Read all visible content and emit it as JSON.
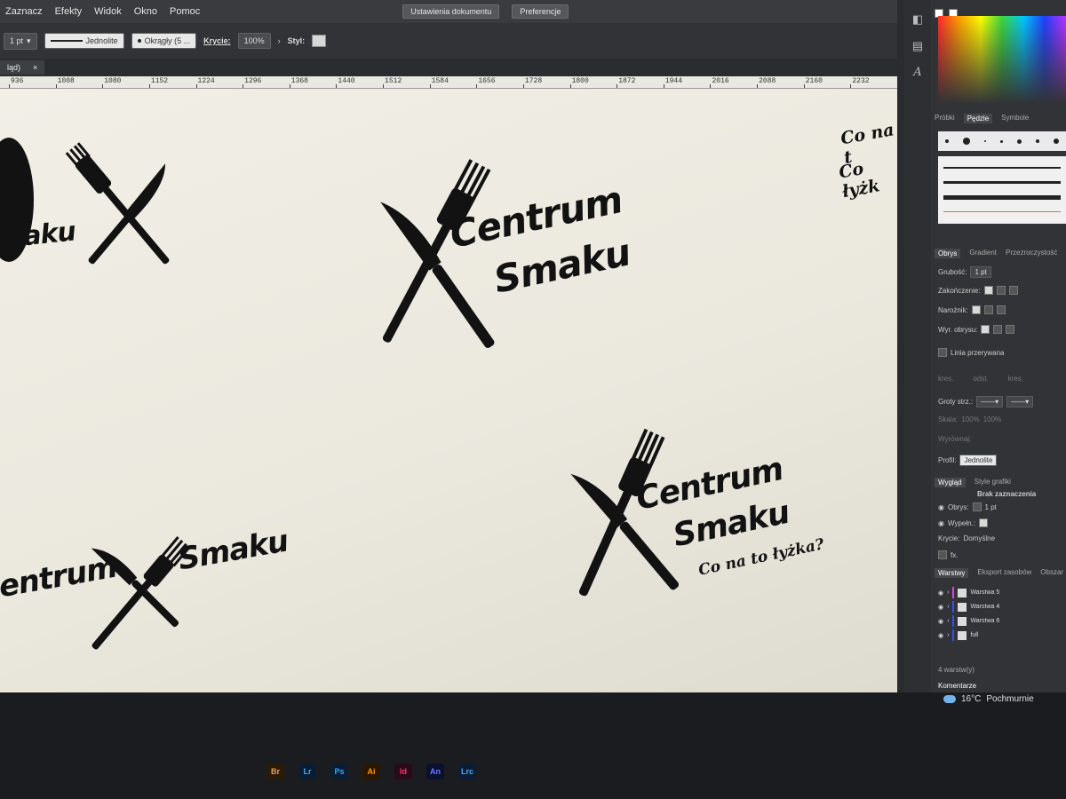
{
  "menu": {
    "items": [
      "Zaznacz",
      "Efekty",
      "Widok",
      "Okno",
      "Pomoc"
    ],
    "document_settings": "Ustawienia dokumentu",
    "preferences": "Preferencje"
  },
  "control_bar": {
    "stroke_weight": "1 pt",
    "stroke_style": "Jednolite",
    "brush": "Okrągły (5 ...",
    "opacity_label": "Krycie:",
    "opacity_value": "100%",
    "style_label": "Styl:"
  },
  "tab": {
    "doc_name": "ląd)",
    "close": "×"
  },
  "ruler": {
    "top": [
      "1728",
      "1800",
      "1872",
      "1944",
      "2016",
      "2088",
      "2160",
      "2232"
    ],
    "mid": [
      "1152",
      "1224",
      "1296",
      "1368",
      "1440",
      "1512",
      "1584",
      "1656"
    ],
    "low": [
      "936",
      "1008",
      "1080"
    ]
  },
  "canvas": {
    "logo_word1": "Centrum",
    "logo_word2": "Smaku",
    "left_partial": "maku",
    "bottom_left": "entrum",
    "bottom_word2": "Smaku",
    "tagline": "Co na to łyżka?",
    "right_partial_1": "Co na t",
    "right_partial_2": "Co łyżk"
  },
  "panel": {
    "swatch_tabs": [
      "Próbki",
      "Pędzle",
      "Symbole"
    ],
    "stroke_tabs": [
      "Obrys",
      "Gradient",
      "Przezroczystość"
    ],
    "weight_label": "Grubość:",
    "weight_value": "1 pt",
    "cap_label": "Zakończenie:",
    "corner_label": "Narożnik:",
    "align_label": "Wyr. obrysu:",
    "dashed_label": "Linia przerywana",
    "dash_labels": [
      "kres.",
      "odst.",
      "kres."
    ],
    "arrows_label": "Groty strz.:",
    "scale_label": "Skala:",
    "scale_values": [
      "100%",
      "100%"
    ],
    "align_arrows_label": "Wyrównaj:",
    "profile_label": "Profil:",
    "profile_value": "Jednolite",
    "appearance_tabs": [
      "Wygląd",
      "Style grafiki"
    ],
    "no_selection": "Brak zaznaczenia",
    "stroke_row": "Obrys:",
    "stroke_row_value": "1 pt",
    "fill_row": "Wypełn.:",
    "opacity_row": "Krycie:",
    "opacity_row_value": "Domyślne",
    "fx": "fx.",
    "layer_tabs": [
      "Warstwy",
      "Eksport zasobów",
      "Obszar"
    ],
    "layers": [
      {
        "name": "Warstwa 5",
        "color": "#e040e0"
      },
      {
        "name": "Warstwa 4",
        "color": "#3050ff"
      },
      {
        "name": "Warstwa 6",
        "color": "#3050ff"
      },
      {
        "name": "full",
        "color": "#3050ff"
      }
    ],
    "layer_count": "4 warstw(y)",
    "comments": "Komentarze"
  },
  "taskbar": {
    "apps": [
      {
        "label": "Br",
        "color": "#2a1a08",
        "fg": "#e8a060"
      },
      {
        "label": "Lr",
        "color": "#0b1d33",
        "fg": "#4ea8f5"
      },
      {
        "label": "Ps",
        "color": "#0b1d33",
        "fg": "#31a8ff"
      },
      {
        "label": "Ai",
        "color": "#2b1600",
        "fg": "#ff9a00"
      },
      {
        "label": "Id",
        "color": "#2a0a18",
        "fg": "#ff3366"
      },
      {
        "label": "An",
        "color": "#0b0f30",
        "fg": "#6a7dff"
      },
      {
        "label": "Lrc",
        "color": "#0b1d33",
        "fg": "#4ea8f5"
      }
    ],
    "weather_temp": "16°C",
    "weather_desc": "Pochmurnie"
  }
}
